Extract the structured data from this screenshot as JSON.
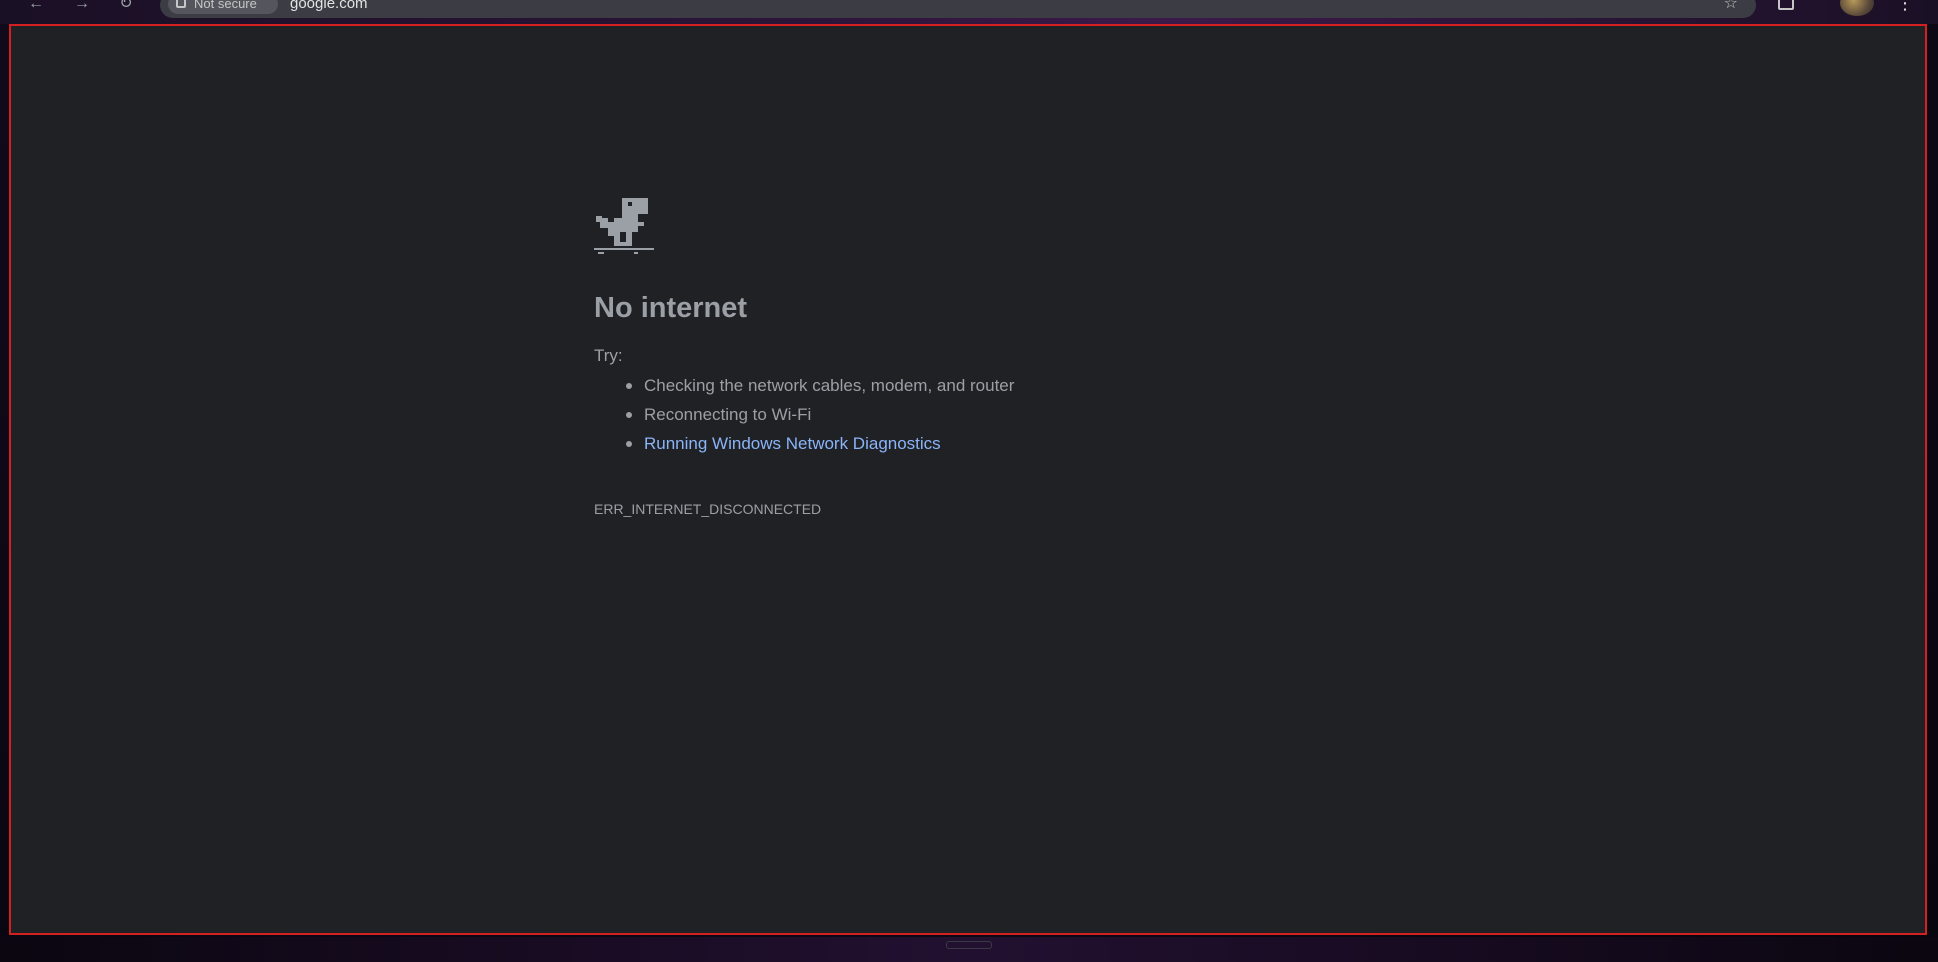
{
  "browser": {
    "back_icon": "back-arrow-icon",
    "forward_icon": "forward-arrow-icon",
    "reload_icon": "reload-icon",
    "site_chip_label": "Not secure",
    "url": "google.com",
    "bookmark_icon": "star-icon",
    "menu_icon": "kebab-menu-icon"
  },
  "error_page": {
    "title": "No internet",
    "try_label": "Try:",
    "suggestions": [
      "Checking the network cables, modem, and router",
      "Reconnecting to Wi-Fi",
      "Running Windows Network Diagnostics"
    ],
    "error_code": "ERR_INTERNET_DISCONNECTED"
  },
  "colors": {
    "page_background": "#202124",
    "text": "#9aa0a6",
    "link": "#8ab4f8",
    "focus_border": "#d42020"
  }
}
